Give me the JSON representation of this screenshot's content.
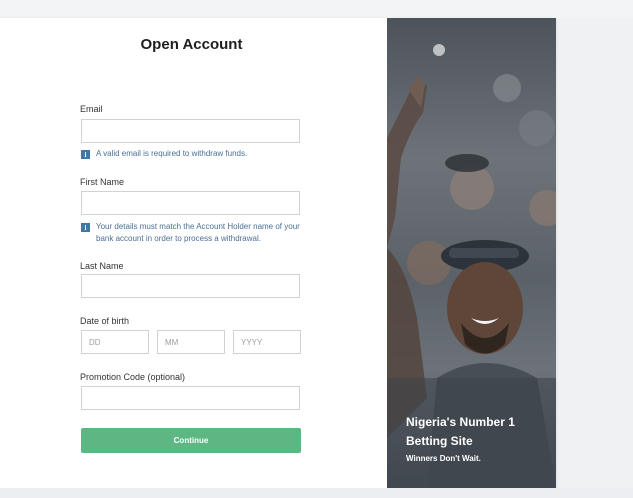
{
  "form": {
    "title": "Open Account",
    "email_label": "Email",
    "email_value": "",
    "email_hint": "A valid email is required to withdraw funds.",
    "first_name_label": "First Name",
    "first_name_value": "",
    "first_name_hint": "Your details must match the Account Holder name of your bank account in order to process a withdrawal.",
    "last_name_label": "Last Name",
    "last_name_value": "",
    "dob_label": "Date of birth",
    "dob_day_placeholder": "DD",
    "dob_month_placeholder": "MM",
    "dob_year_placeholder": "YYYY",
    "promo_label": "Promotion Code (optional)",
    "promo_value": "",
    "continue_label": "Continue",
    "info_icon": "info-icon"
  },
  "hero": {
    "title": "Nigeria's Number 1 Betting Site",
    "subtitle": "Winners Don't Wait."
  },
  "colors": {
    "continue_button": "#5cb783",
    "info_icon": "#3f78a8",
    "hint_text": "#4a6f96"
  }
}
